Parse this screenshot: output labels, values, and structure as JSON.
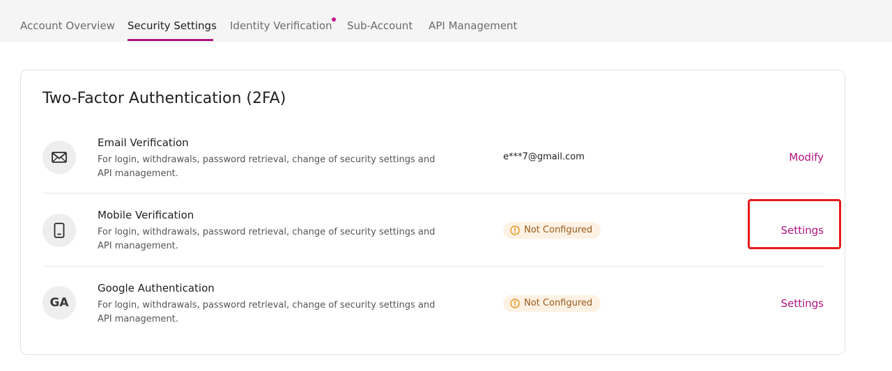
{
  "tabs": [
    {
      "label": "Account Overview",
      "active": false
    },
    {
      "label": "Security Settings",
      "active": true
    },
    {
      "label": "Identity Verification",
      "active": false,
      "notification_dot": true
    },
    {
      "label": "Sub-Account",
      "active": false
    },
    {
      "label": "API Management",
      "active": false
    }
  ],
  "colors": {
    "accent": "#b0137e",
    "badge_bg": "#fdf1e3",
    "badge_text": "#9a5a1a",
    "warning_icon": "#e59a2a",
    "highlight": "#e8191a"
  },
  "card": {
    "title": "Two-Factor Authentication (2FA)",
    "rows": [
      {
        "icon": "envelope-icon",
        "title": "Email Verification",
        "description": "For login, withdrawals, password retrieval, change of security settings and API management.",
        "value": "e***7@gmail.com",
        "action": "Modify"
      },
      {
        "icon": "mobile-phone-icon",
        "title": "Mobile Verification",
        "description": "For login, withdrawals, password retrieval, change of security settings and API management.",
        "status": "Not Configured",
        "action": "Settings",
        "highlighted": true
      },
      {
        "icon": "google-authenticator-icon",
        "icon_text": "GA",
        "title": "Google Authentication",
        "description": "For login, withdrawals, password retrieval, change of security settings and API management.",
        "status": "Not Configured",
        "action": "Settings"
      }
    ]
  }
}
